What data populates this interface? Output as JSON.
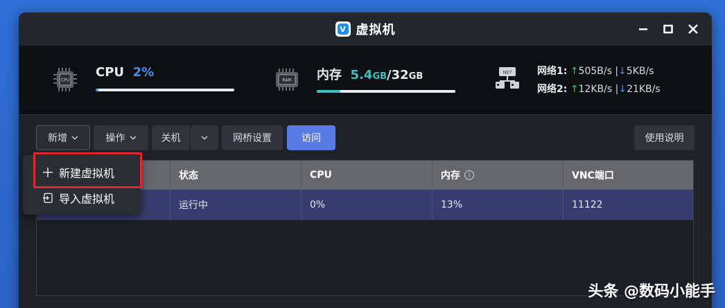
{
  "window": {
    "title": "虚拟机",
    "app_icon_letter": "V"
  },
  "stats": {
    "cpu": {
      "label": "CPU",
      "value": "2%",
      "usage_fraction": 0.02
    },
    "memory": {
      "label": "内存",
      "used": "5.4",
      "used_unit": "GB",
      "separator": "/",
      "total": "32",
      "total_unit": "GB",
      "usage_fraction": 0.17
    },
    "network": [
      {
        "label": "网络1:",
        "up": "505B/s",
        "sep": "|",
        "down": "5KB/s"
      },
      {
        "label": "网络2:",
        "up": "12KB/s",
        "sep": "|",
        "down": "21KB/s"
      }
    ],
    "icons": {
      "cpu": "CPU",
      "ram": "RAM",
      "net": "NET"
    }
  },
  "toolbar": {
    "add": "新增",
    "operate": "操作",
    "shutdown": "关机",
    "bridge": "网桥设置",
    "visit": "访问",
    "help": "使用说明"
  },
  "table": {
    "columns": [
      "状态",
      "CPU",
      "内存",
      "VNC端口"
    ],
    "rows": [
      {
        "status": "运行中",
        "cpu": "0%",
        "memory": "13%",
        "vnc": "11122"
      }
    ]
  },
  "menu": {
    "items": [
      {
        "label": "新建虚拟机",
        "icon": "plus-icon"
      },
      {
        "label": "导入虚拟机",
        "icon": "import-icon"
      }
    ]
  },
  "watermark": "头条 @数码小能手",
  "colors": {
    "accent": "#5a7be3",
    "cpu": "#4a8df0",
    "memory": "#3cc1c0",
    "up": "#3cc46a",
    "highlight": "#e1262c"
  }
}
